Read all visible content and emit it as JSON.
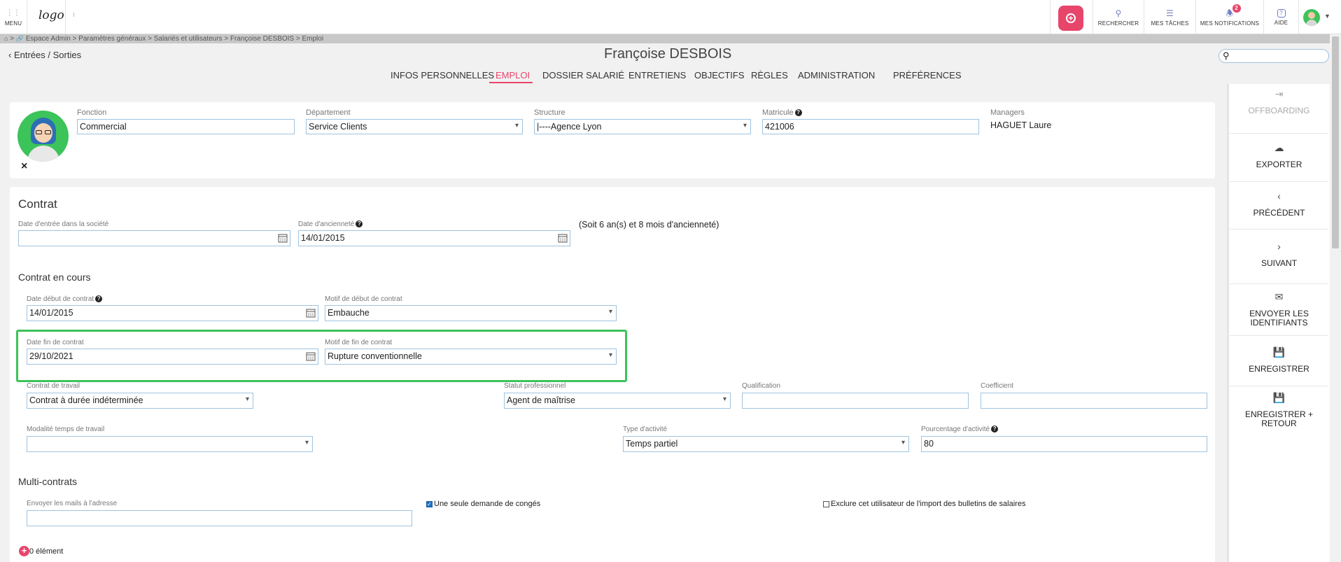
{
  "topbar": {
    "menu_label": "MENU",
    "logo_text": "logo",
    "search_label": "RECHERCHER",
    "tasks_label": "MES TÂCHES",
    "notifications_label": "MES NOTIFICATIONS",
    "notifications_count": "2",
    "help_label": "AIDE"
  },
  "breadcrumb": "Espace Admin > Paramètres généraux > Salariés et utilisateurs > Françoise DESBOIS > Emploi",
  "back_link": "Entrées / Sorties",
  "page_title": "Françoise DESBOIS",
  "tabs": [
    "INFOS PERSONNELLES",
    "EMPLOI",
    "DOSSIER SALARIÉ",
    "ENTRETIENS",
    "OBJECTIFS",
    "RÈGLES",
    "ADMINISTRATION",
    "PRÉFÉRENCES"
  ],
  "active_tab": "EMPLOI",
  "header_card": {
    "fonction_label": "Fonction",
    "fonction_value": "Commercial",
    "departement_label": "Département",
    "departement_value": "Service Clients",
    "structure_label": "Structure",
    "structure_value": "|----Agence Lyon",
    "matricule_label": "Matricule",
    "matricule_value": "421006",
    "managers_label": "Managers",
    "managers_value": "HAGUET Laure",
    "remove_icon": "×"
  },
  "contrat": {
    "title": "Contrat",
    "date_entree_label": "Date d'entrée dans la société",
    "date_entree_value": "",
    "date_anciennete_label": "Date d'ancienneté",
    "date_anciennete_value": "14/01/2015",
    "anciennete_text": "(Soit 6 an(s) et 8 mois d'ancienneté)",
    "en_cours_title": "Contrat en cours",
    "date_debut_label": "Date début de contrat",
    "date_debut_value": "14/01/2015",
    "motif_debut_label": "Motif de début de contrat",
    "motif_debut_value": "Embauche",
    "date_fin_label": "Date fin de contrat",
    "date_fin_value": "29/10/2021",
    "motif_fin_label": "Motif de fin de contrat",
    "motif_fin_value": "Rupture conventionnelle",
    "contrat_travail_label": "Contrat de travail",
    "contrat_travail_value": "Contrat à durée indéterminée",
    "statut_label": "Statut professionnel",
    "statut_value": "Agent de maîtrise",
    "qualification_label": "Qualification",
    "qualification_value": "",
    "coefficient_label": "Coefficient",
    "coefficient_value": "",
    "modalite_label": "Modalité temps de travail",
    "modalite_value": "",
    "type_activite_label": "Type d'activité",
    "type_activite_value": "Temps partiel",
    "pourcentage_label": "Pourcentage d'activité",
    "pourcentage_value": "80"
  },
  "multi": {
    "title": "Multi-contrats",
    "mails_label": "Envoyer les mails à l'adresse",
    "mails_value": "",
    "conges_label": "Une seule demande de congés",
    "conges_checked": true,
    "exclure_label": "Exclure cet utilisateur de l'import des bulletins de salaires",
    "exclure_checked": false,
    "elements_text": "0 élément"
  },
  "sidebar": {
    "offboarding": "OFFBOARDING",
    "exporter": "EXPORTER",
    "precedent": "PRÉCÉDENT",
    "suivant": "SUIVANT",
    "envoyer": "ENVOYER LES IDENTIFIANTS",
    "enregistrer": "ENREGISTRER",
    "enregistrer_retour": "ENREGISTRER + RETOUR"
  },
  "colors": {
    "accent": "#e8456b",
    "highlight": "#3cc35a",
    "field_border": "#9fc3df"
  }
}
